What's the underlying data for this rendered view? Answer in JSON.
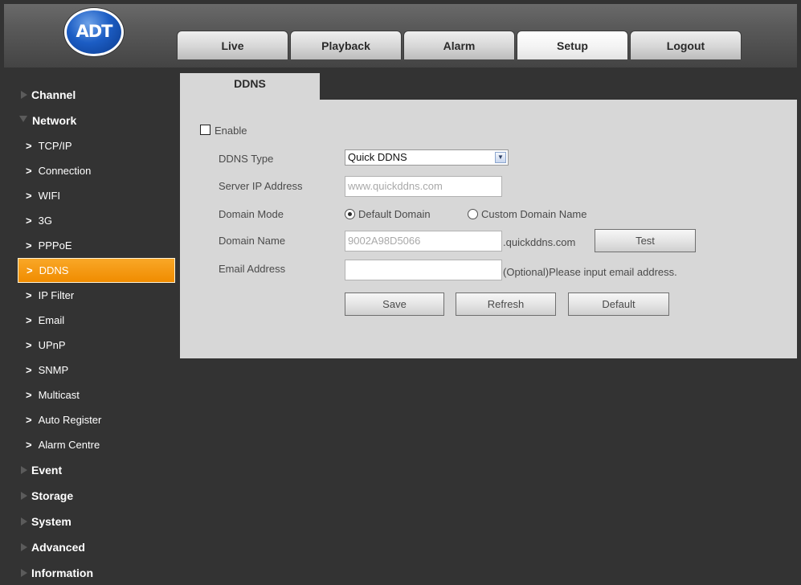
{
  "logo": {
    "text": "ADT"
  },
  "nav": {
    "tabs": [
      {
        "label": "Live"
      },
      {
        "label": "Playback"
      },
      {
        "label": "Alarm"
      },
      {
        "label": "Setup"
      },
      {
        "label": "Logout"
      }
    ],
    "active_tab": "Setup"
  },
  "sidebar": {
    "channel": "Channel",
    "network": "Network",
    "network_items": [
      "TCP/IP",
      "Connection",
      "WIFI",
      "3G",
      "PPPoE",
      "DDNS",
      "IP Filter",
      "Email",
      "UPnP",
      "SNMP",
      "Multicast",
      "Auto Register",
      "Alarm Centre"
    ],
    "active_item": "DDNS",
    "event": "Event",
    "storage": "Storage",
    "system": "System",
    "advanced": "Advanced",
    "information": "Information",
    "chevron": ">"
  },
  "content": {
    "tab_title": "DDNS",
    "enable_label": "Enable",
    "enable_checked": false,
    "ddns_type_label": "DDNS Type",
    "ddns_type_value": "Quick DDNS",
    "server_ip_label": "Server IP Address",
    "server_ip_value": "www.quickddns.com",
    "domain_mode_label": "Domain Mode",
    "domain_mode_options": [
      "Default Domain",
      "Custom Domain Name"
    ],
    "domain_mode_selected": "Default Domain",
    "domain_name_label": "Domain Name",
    "domain_name_value": "9002A98D5066",
    "domain_suffix": ".quickddns.com",
    "test_button": "Test",
    "email_label": "Email Address",
    "email_value": "",
    "email_hint": "(Optional)Please input email address.",
    "save_button": "Save",
    "refresh_button": "Refresh",
    "default_button": "Default"
  }
}
